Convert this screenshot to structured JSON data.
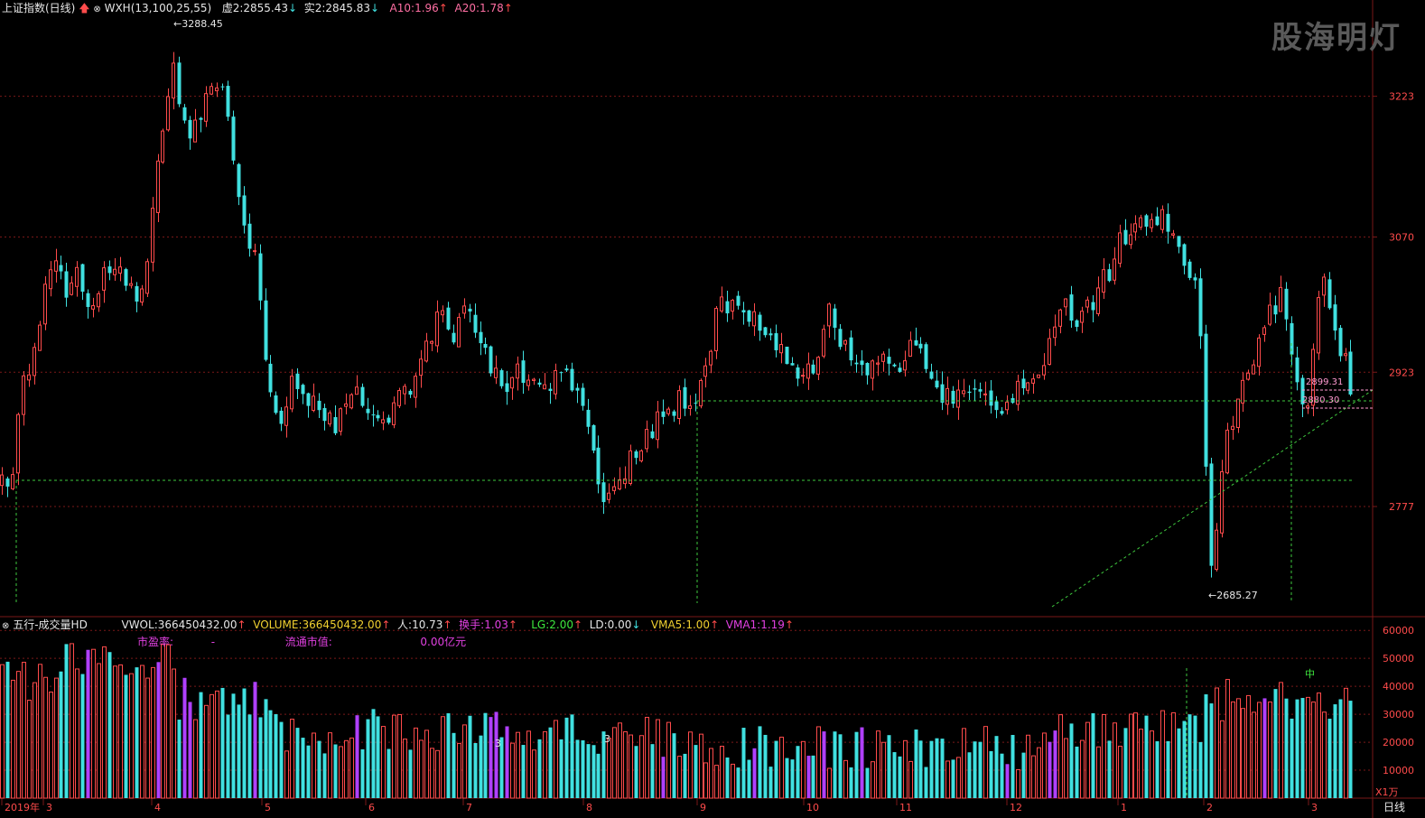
{
  "header": {
    "title": "上证指数(日线)",
    "indicator": "WXH(13,100,25,55)",
    "xu2_label": "虚2:",
    "xu2_value": "2855.43",
    "shi2_label": "实2:",
    "shi2_value": "2845.83",
    "a10_label": "A10:",
    "a10_value": "1.96",
    "a20_label": "A20:",
    "a20_value": "1.78"
  },
  "watermark": "股海明灯",
  "annotations": {
    "high": "3288.45",
    "low": "2685.27",
    "level1": "2899.31",
    "level2": "2880.30"
  },
  "volume_header": {
    "title": "五行-成交量HD",
    "vwol_label": "VWOL:",
    "vwol_value": "366450432.00",
    "volume_label": "VOLUME:",
    "volume_value": "366450432.00",
    "ren_label": "人:",
    "ren_value": "10.73",
    "huanshou_label": "换手:",
    "huanshou_value": "1.03",
    "lg_label": "LG:",
    "lg_value": "2.00",
    "ld_label": "LD:",
    "ld_value": "0.00",
    "vma5_label": "VMA5:",
    "vma5_value": "1.00",
    "vma1_label": "VMA1:",
    "vma1_value": "1.19",
    "pe_label": "市盈率:",
    "pe_value": "-",
    "mcap_label": "流通市值:",
    "mcap_value": "0.00亿元"
  },
  "volume_marks": {
    "mark_a": "3",
    "mark_b": "3",
    "mark_zhong": "中"
  },
  "volume_unit": "X1万",
  "period_label": "日线",
  "colors": {
    "up": "#ff4b4b",
    "down": "#40e0e0",
    "purple": "#b040ff",
    "grid": "#7a1818",
    "dashed": "#3ec83e"
  },
  "chart_data": {
    "type": "candlestick",
    "price_axis": {
      "ticks": [
        3223,
        3070,
        2923,
        2777
      ],
      "range": [
        2670,
        3310
      ]
    },
    "volume_axis": {
      "ticks": [
        60000,
        50000,
        40000,
        30000,
        20000,
        10000
      ],
      "unit": "X1万",
      "range": [
        0,
        62000
      ]
    },
    "x_ticks": [
      "2019年",
      "3",
      "4",
      "5",
      "6",
      "7",
      "8",
      "9",
      "10",
      "11",
      "12",
      "1",
      "2",
      "3"
    ],
    "high": 3288.45,
    "low": 2685.27,
    "levels": [
      2899.31,
      2880.3
    ]
  }
}
